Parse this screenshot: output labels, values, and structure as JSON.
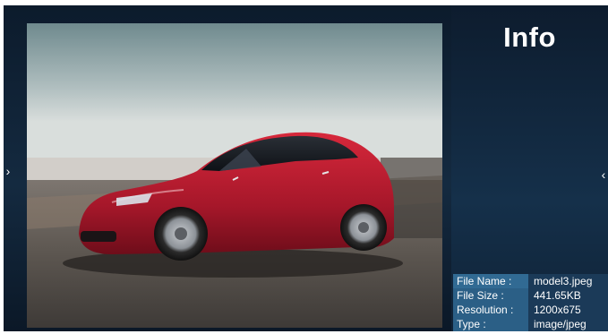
{
  "viewer": {
    "prev_icon": "chevron-right-icon",
    "next_icon": "chevron-left-icon",
    "prev_glyph": "›",
    "next_glyph": "‹"
  },
  "info_panel": {
    "title": "Info",
    "rows": [
      {
        "label": "File Name :",
        "value": "model3.jpeg"
      },
      {
        "label": "File Size :",
        "value": "441.65KB"
      },
      {
        "label": "Resolution :",
        "value": "1200x675"
      },
      {
        "label": "Type :",
        "value": "image/jpeg"
      }
    ]
  },
  "colors": {
    "background": "#142a40",
    "label_cell": "#2b5f86",
    "value_cell": "#1b3a58",
    "car_body": "#b0182a"
  }
}
